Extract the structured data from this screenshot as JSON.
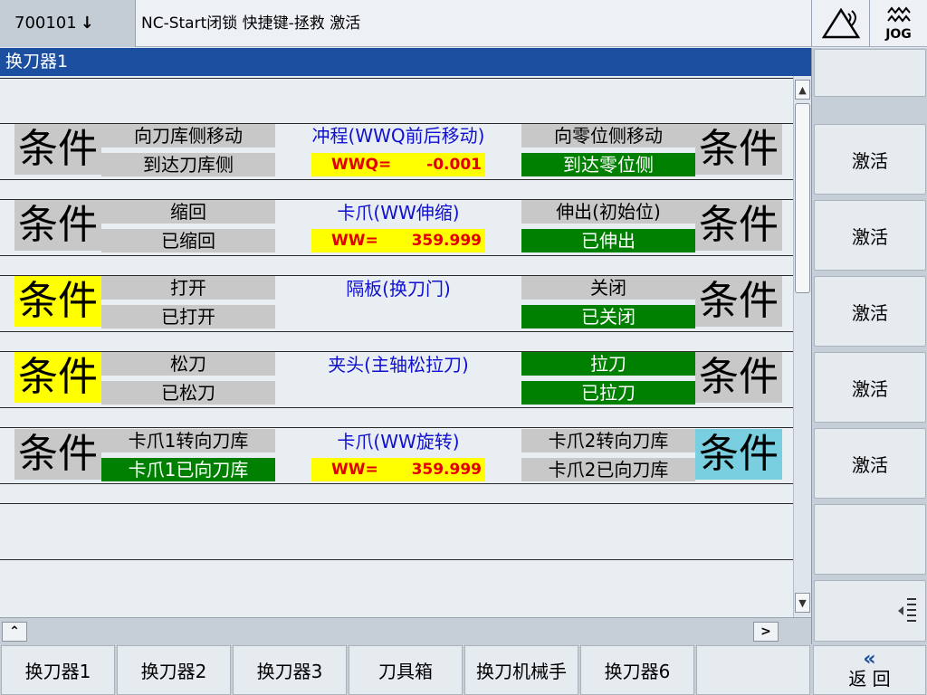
{
  "header": {
    "alarm_number": "700101",
    "alarm_text": "NC-Start闭锁 快捷键-拯救 激活",
    "mode_label": "JOG"
  },
  "title": "换刀器1",
  "rows": [
    {
      "left_condition": "条件",
      "left_top": "向刀库侧移动",
      "left_bottom": "到达刀库侧",
      "center_title": "冲程(WWQ前后移动)",
      "center_value_label": "WWQ=",
      "center_value": "-0.001",
      "right_top": "向零位侧移动",
      "right_bottom": "到达零位侧",
      "right_condition": "条件"
    },
    {
      "left_condition": "条件",
      "left_top": "缩回",
      "left_bottom": "已缩回",
      "center_title": "卡爪(WW伸缩)",
      "center_value_label": "WW=",
      "center_value": "359.999",
      "right_top": "伸出(初始位)",
      "right_bottom": "已伸出",
      "right_condition": "条件"
    },
    {
      "left_condition": "条件",
      "left_top": "打开",
      "left_bottom": "已打开",
      "center_title": "隔板(换刀门)",
      "right_top": "关闭",
      "right_bottom": "已关闭",
      "right_condition": "条件"
    },
    {
      "left_condition": "条件",
      "left_top": "松刀",
      "left_bottom": "已松刀",
      "center_title": "夹头(主轴松拉刀)",
      "right_top": "拉刀",
      "right_bottom": "已拉刀",
      "right_condition": "条件"
    },
    {
      "left_condition": "条件",
      "left_top": "卡爪1转向刀库",
      "left_bottom": "卡爪1已向刀库",
      "center_title": "卡爪(WW旋转)",
      "center_value_label": "WW=",
      "center_value": "359.999",
      "right_top": "卡爪2转向刀库",
      "right_bottom": "卡爪2已向刀库",
      "right_condition": "条件"
    }
  ],
  "vertical_softkeys": [
    "激活",
    "激活",
    "激活",
    "激活",
    "激活"
  ],
  "horizontal_softkeys": [
    "换刀器1",
    "换刀器2",
    "换刀器3",
    "刀具箱",
    "换刀机械手",
    "换刀器6"
  ],
  "back_label": "返 回",
  "colors": {
    "title_bar": "#1d4fa0",
    "active_green": "#008000",
    "condition_yellow": "#ffff00",
    "condition_cyan": "#79cfdf",
    "value_red": "#e00000",
    "label_blue": "#1010d0"
  },
  "icons": {
    "alarm_arrow": "down-arrow-icon",
    "alarm_status": "alarm-triangle-icon",
    "mode": "jog-icon",
    "back": "double-chevron-left-icon",
    "extend": "list-extend-icon"
  }
}
